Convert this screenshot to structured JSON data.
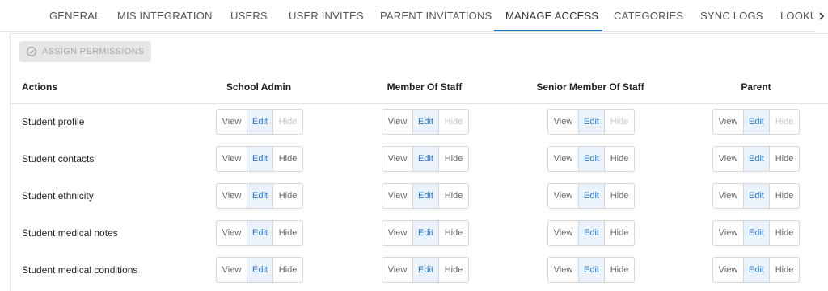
{
  "tabs": [
    {
      "label": "GENERAL"
    },
    {
      "label": "MIS INTEGRATION"
    },
    {
      "label": "USERS"
    },
    {
      "label": "USER INVITES"
    },
    {
      "label": "PARENT INVITATIONS"
    },
    {
      "label": "MANAGE ACCESS",
      "active": true
    },
    {
      "label": "CATEGORIES"
    },
    {
      "label": "SYNC LOGS"
    },
    {
      "label": "LOOKUPS"
    }
  ],
  "toolbar": {
    "assign_label": "ASSIGN PERMISSIONS"
  },
  "table": {
    "actions_header": "Actions",
    "roles": [
      "School Admin",
      "Member Of Staff",
      "Senior Member Of Staff",
      "Parent"
    ],
    "option_labels": {
      "view": "View",
      "edit": "Edit",
      "hide": "Hide"
    },
    "rows": [
      {
        "label": "Student profile",
        "selected": [
          "Edit",
          "Edit",
          "Edit",
          "Edit"
        ],
        "hide_disabled": true
      },
      {
        "label": "Student contacts",
        "selected": [
          "Edit",
          "Edit",
          "Edit",
          "Edit"
        ],
        "hide_disabled": false
      },
      {
        "label": "Student ethnicity",
        "selected": [
          "Edit",
          "Edit",
          "Edit",
          "Edit"
        ],
        "hide_disabled": false
      },
      {
        "label": "Student medical notes",
        "selected": [
          "Edit",
          "Edit",
          "Edit",
          "Edit"
        ],
        "hide_disabled": false
      },
      {
        "label": "Student medical conditions",
        "selected": [
          "Edit",
          "Edit",
          "Edit",
          "Edit"
        ],
        "hide_disabled": false
      }
    ]
  },
  "colors": {
    "accent": "#1e73c9",
    "selected_bg": "#eaf2fb",
    "selected_text": "#2a78c8",
    "border": "#d7d7d7"
  }
}
